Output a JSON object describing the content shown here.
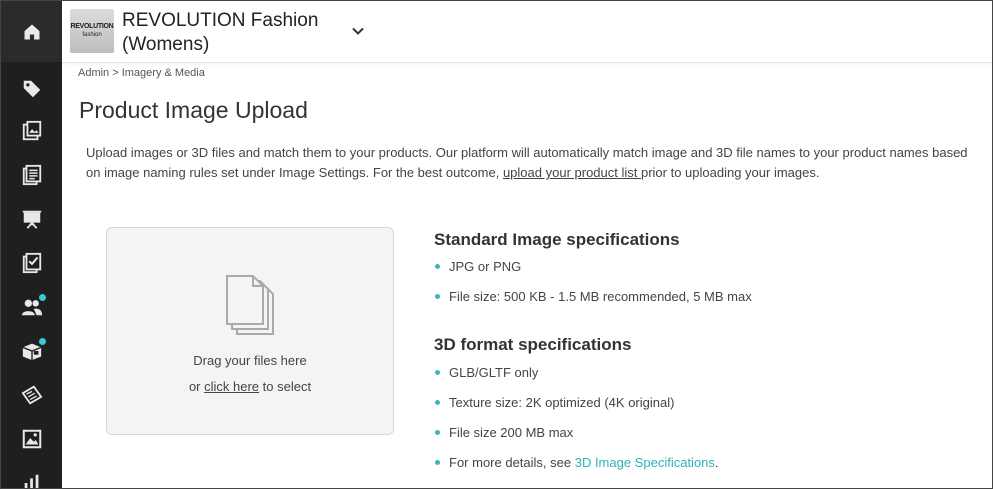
{
  "header": {
    "logo_line1": "REVOLUTION",
    "logo_line2": "fashion",
    "brand_name": "REVOLUTION Fashion (Womens)"
  },
  "breadcrumb": "Admin > Imagery & Media",
  "page_title": "Product Image Upload",
  "description": {
    "text_before": "Upload images or 3D files and match them to your products. Our platform will automatically match image and 3D file names to your product names based on image naming rules set under Image Settings. For the best outcome, ",
    "link": "upload your product list ",
    "text_after": "prior to uploading your images."
  },
  "dropzone": {
    "drag_text": "Drag your files here",
    "or_text": "or ",
    "click_link": "click here",
    "to_select": " to select"
  },
  "standard_specs": {
    "heading": "Standard Image specifications",
    "items": [
      "JPG or PNG",
      "File size: 500 KB - 1.5 MB recommended, 5 MB max"
    ]
  },
  "specs_3d": {
    "heading": "3D format specifications",
    "items": [
      "GLB/GLTF only",
      "Texture size: 2K optimized (4K original)",
      "File size 200 MB max"
    ],
    "details_prefix": "For more details, see ",
    "details_link": "3D Image Specifications",
    "details_suffix": "."
  },
  "colors": {
    "sidebar": "#1f1f1f",
    "accent": "#3cc6cf"
  },
  "sidebar_icons": [
    "home-icon",
    "tag-icon",
    "image-gallery-icon",
    "catalog-icon",
    "presentation-icon",
    "checklist-icon",
    "users-icon",
    "box-icon",
    "orders-icon",
    "media-icon",
    "analytics-icon"
  ]
}
